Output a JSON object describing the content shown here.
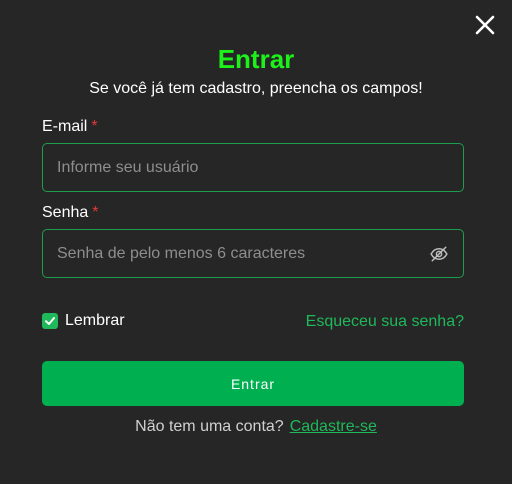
{
  "modal": {
    "title": "Entrar",
    "subtitle": "Se você já tem cadastro, preencha os campos!",
    "close_icon": "close-icon"
  },
  "email": {
    "label": "E-mail",
    "required_mark": "*",
    "value": "",
    "placeholder": "Informe seu usuário"
  },
  "password": {
    "label": "Senha",
    "required_mark": "*",
    "value": "",
    "placeholder": "Senha de pelo menos 6 caracteres",
    "toggle_icon": "eye-off-icon"
  },
  "remember": {
    "label": "Lembrar",
    "checked": true
  },
  "forgot_link": "Esqueceu sua senha?",
  "submit_label": "Entrar",
  "signup": {
    "prompt": "Não tem uma conta?",
    "link": "Cadastre-se"
  },
  "colors": {
    "background": "#262626",
    "title": "#1cf11a",
    "accent": "#00b050",
    "link": "#1fb85a",
    "required": "#e53935",
    "field_border": "#1f9d4e"
  }
}
